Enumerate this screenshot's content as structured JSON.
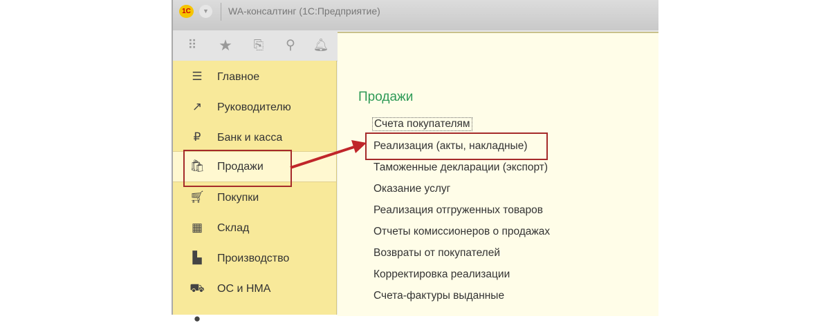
{
  "window": {
    "title": "WA-консалтинг  (1С:Предприятие)",
    "logo": "1С"
  },
  "toolbar": {
    "icons": [
      "apps-grid-icon",
      "star-icon",
      "history-icon",
      "search-icon",
      "bell-icon"
    ]
  },
  "sidebar": {
    "items": [
      {
        "label": "Главное",
        "icon": "menu-icon"
      },
      {
        "label": "Руководителю",
        "icon": "trend-icon"
      },
      {
        "label": "Банк и касса",
        "icon": "ruble-icon"
      },
      {
        "label": "Продажи",
        "icon": "bag-icon",
        "active": true
      },
      {
        "label": "Покупки",
        "icon": "cart-icon"
      },
      {
        "label": "Склад",
        "icon": "warehouse-icon"
      },
      {
        "label": "Производство",
        "icon": "factory-icon"
      },
      {
        "label": "ОС и НМА",
        "icon": "truck-icon"
      }
    ]
  },
  "content": {
    "section_title": "Продажи",
    "links": [
      "Счета покупателям",
      "Реализация (акты, накладные)",
      "Таможенные декларации (экспорт)",
      "Оказание услуг",
      "Реализация отгруженных товаров",
      "Отчеты комиссионеров о продажах",
      "Возвраты от покупателей",
      "Корректировка реализации",
      "Счета-фактуры выданные"
    ]
  },
  "colors": {
    "highlight": "#a52a2a",
    "section": "#2e9a56",
    "sidebar": "#f8e99a"
  }
}
